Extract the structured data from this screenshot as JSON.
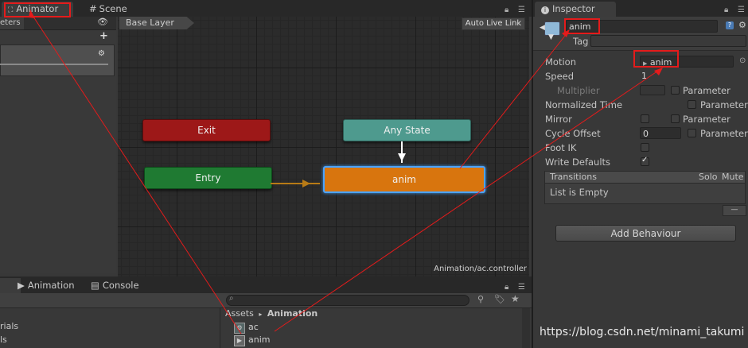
{
  "tabs": {
    "animator": "Animator",
    "scene": "Scene",
    "inspector": "Inspector"
  },
  "animator": {
    "left_tab_label": "eters",
    "layer_name": "Base Layer",
    "auto_live_link": "Auto Live Link",
    "footer_path": "Animation/ac.controller",
    "nodes": {
      "exit": "Exit",
      "any_state": "Any State",
      "entry": "Entry",
      "anim": "anim"
    }
  },
  "bottom_tabs": {
    "animation": "Animation",
    "console": "Console"
  },
  "project": {
    "breadcrumb_root": "Assets",
    "breadcrumb_sep": "▸",
    "breadcrumb_current": "Animation",
    "left_items": [
      "rials",
      "ls"
    ],
    "assets": [
      {
        "name": "ac",
        "icon": "animator-controller-icon"
      },
      {
        "name": "anim",
        "icon": "animation-clip-icon"
      }
    ]
  },
  "inspector": {
    "name_value": "anim",
    "tag_label": "Tag",
    "rows": {
      "motion_label": "Motion",
      "motion_value": "anim",
      "speed_label": "Speed",
      "speed_value": "1",
      "multiplier_label": "Multiplier",
      "parameter_label": "Parameter",
      "normalized_time_label": "Normalized Time",
      "mirror_label": "Mirror",
      "cycle_offset_label": "Cycle Offset",
      "cycle_offset_value": "0",
      "foot_ik_label": "Foot IK",
      "write_defaults_label": "Write Defaults"
    },
    "write_defaults_checked": true,
    "transitions": {
      "header": "Transitions",
      "solo": "Solo",
      "mute": "Mute",
      "empty": "List is Empty",
      "remove": "—"
    },
    "add_behaviour": "Add Behaviour"
  },
  "watermark": "https://blog.csdn.net/minami_takumi",
  "colors": {
    "exit": "#9d1818",
    "any_state": "#4e9a8e",
    "entry": "#1f7a32",
    "anim": "#d8750e",
    "highlight": "#e41b1b"
  }
}
